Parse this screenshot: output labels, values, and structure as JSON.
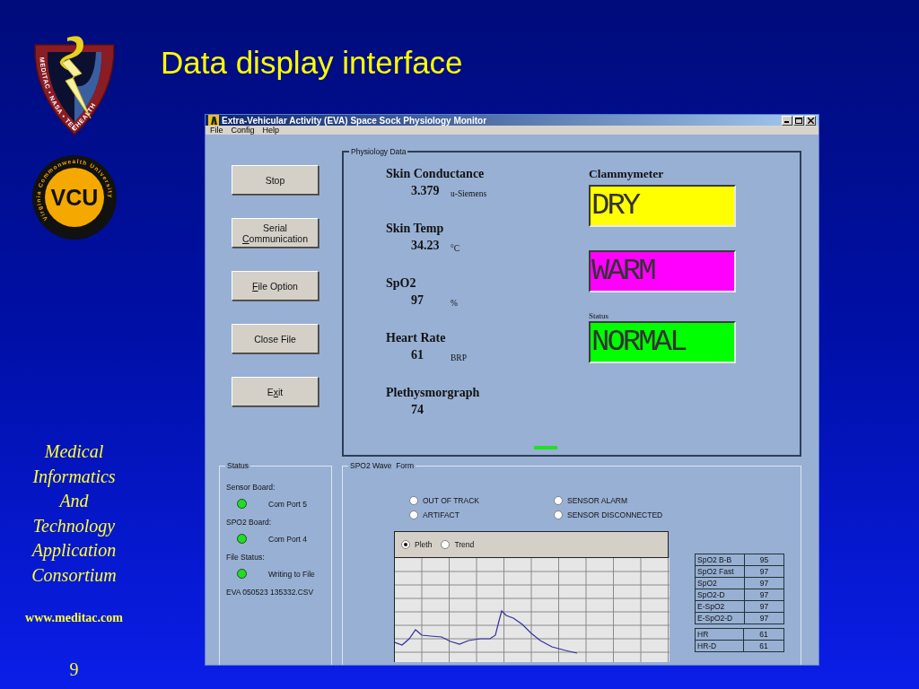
{
  "slide": {
    "title": "Data display interface",
    "logos": [
      {
        "kind": "shield",
        "text": "MEDITAC • NASA • TELEHEALTH"
      },
      {
        "kind": "seal",
        "text": "VCU",
        "ring": "Virginia Commonwealth University"
      }
    ],
    "footer": {
      "lines": [
        "Medical",
        "Informatics",
        "And",
        "Technology",
        "Application",
        "Consortium"
      ],
      "url": "www.meditac.com",
      "page": "9"
    }
  },
  "window": {
    "title": "Extra-Vehicular Activity (EVA) Space Sock Physiology Monitor",
    "menu": [
      "File",
      "Config",
      "Help"
    ],
    "buttons": [
      {
        "lines": [
          {
            "text": "Stop"
          }
        ]
      },
      {
        "lines": [
          {
            "text": "Serial"
          },
          {
            "key": "C",
            "after": "ommunication"
          }
        ]
      },
      {
        "lines": [
          {
            "key": "F",
            "after": "ile Option"
          }
        ]
      },
      {
        "lines": [
          {
            "text": "Close File"
          }
        ]
      },
      {
        "lines": [
          {
            "before": "E",
            "key": "x",
            "after": "it"
          }
        ]
      }
    ],
    "physiology": {
      "title": "Physiology Data",
      "readings": [
        {
          "label": "Skin Conductance",
          "value": "3.379",
          "unit": "u-Siemens"
        },
        {
          "label": "Skin Temp",
          "value": "34.23",
          "unit": "°C"
        },
        {
          "label": "SpO2",
          "value": "97",
          "unit": "%"
        },
        {
          "label": "Heart Rate",
          "value": "61",
          "unit": "BRP"
        },
        {
          "label": "Plethysmorgraph",
          "value": "74"
        }
      ],
      "clammymeter": {
        "title": "Clammymeter",
        "displays": [
          {
            "text": "DRY",
            "color": "#ffff00"
          },
          {
            "text": "WARM",
            "color": "#ff00ff"
          },
          {
            "label": "Status",
            "text": "NORMAL",
            "color": "#00ff00"
          }
        ]
      }
    },
    "status": {
      "title": "Status",
      "items": [
        {
          "label": "Sensor Board:",
          "on": true,
          "text": "Com Port 5"
        },
        {
          "label": "SPO2 Board:",
          "on": true,
          "text": "Com Port 4"
        },
        {
          "label": "File Status:",
          "on": true,
          "text": "Writing to File"
        }
      ],
      "file": "EVA 050523 135332.CSV"
    },
    "wave": {
      "title": "SPO2 Wave  Form",
      "alarms": [
        {
          "label": "OUT OF TRACK",
          "checked": false
        },
        {
          "label": "ARTIFACT",
          "checked": false
        },
        {
          "label": "SENSOR ALARM",
          "checked": false
        },
        {
          "label": "SENSOR DISCONNECTED",
          "checked": false
        }
      ],
      "modes": [
        {
          "label": "Pleth",
          "selected": true
        },
        {
          "label": "Trend",
          "selected": false
        }
      ],
      "tables": [
        [
          {
            "name": "SpO2 B-B",
            "value": "95"
          },
          {
            "name": "SpO2 Fast",
            "value": "97"
          },
          {
            "name": "SpO2",
            "value": "97"
          },
          {
            "name": "SpO2-D",
            "value": "97"
          },
          {
            "name": "E-SpO2",
            "value": "97"
          },
          {
            "name": "E-SpO2-D",
            "value": "97"
          }
        ],
        [
          {
            "name": "HR",
            "value": "61"
          },
          {
            "name": "HR-D",
            "value": "61"
          }
        ]
      ]
    }
  }
}
